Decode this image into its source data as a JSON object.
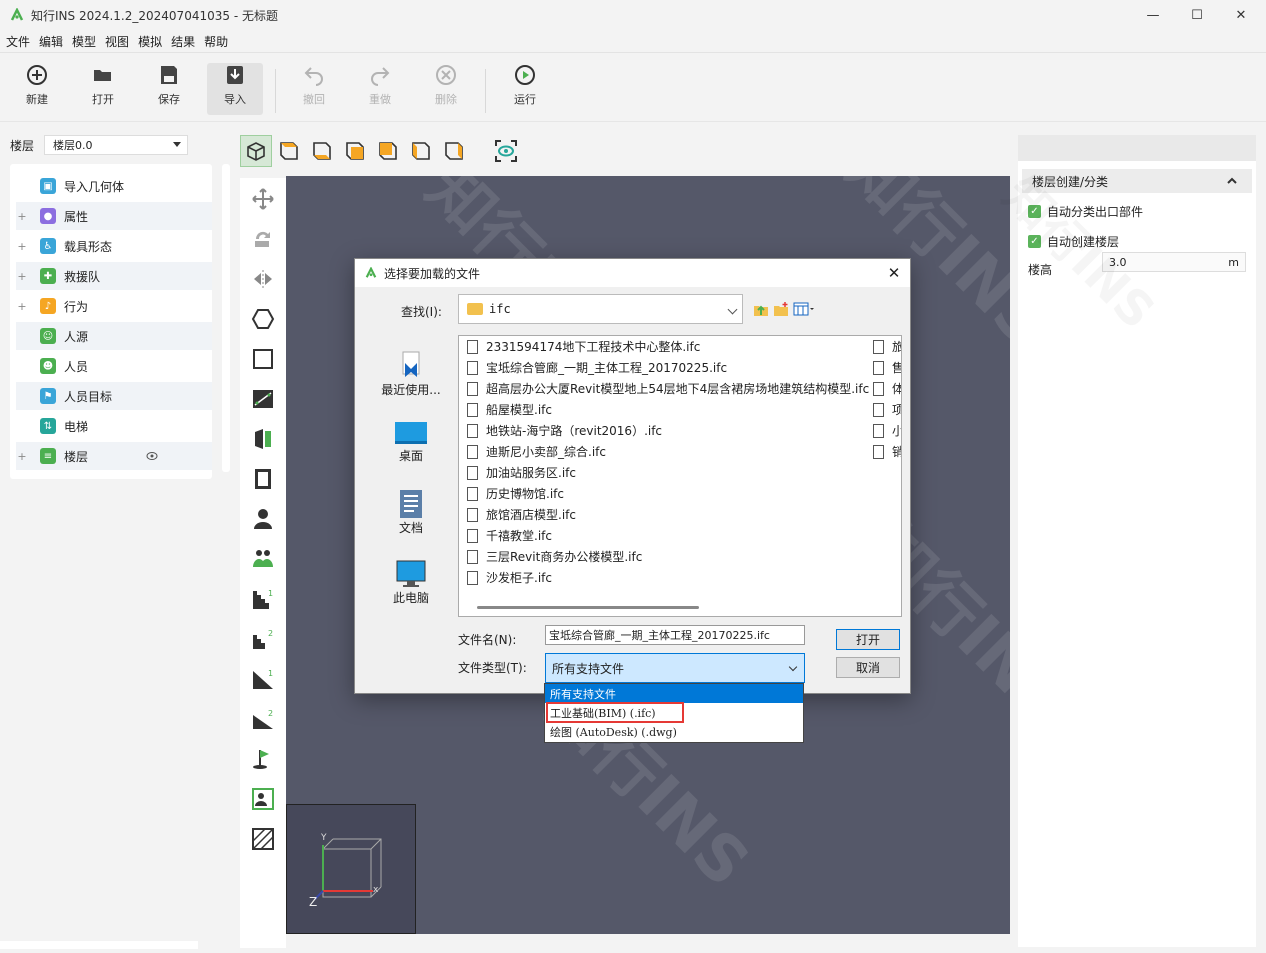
{
  "window": {
    "title": "知行INS 2024.1.2_202407041035 - 无标题",
    "controls": [
      "—",
      "☐",
      "✕"
    ]
  },
  "menu": [
    "文件",
    "编辑",
    "模型",
    "视图",
    "模拟",
    "结果",
    "帮助"
  ],
  "toolbar": {
    "new": "新建",
    "open": "打开",
    "save": "保存",
    "import": "导入",
    "undo": "撤回",
    "redo": "重做",
    "delete": "删除",
    "run": "运行"
  },
  "floor": {
    "label": "楼层",
    "value": "楼层0.0"
  },
  "tree": [
    {
      "label": "导入几何体",
      "expand": "",
      "color": "#3aa5d8"
    },
    {
      "label": "属性",
      "expand": "+",
      "color": "#8c6ee0"
    },
    {
      "label": "载具形态",
      "expand": "+",
      "color": "#3aa5d8"
    },
    {
      "label": "救援队",
      "expand": "+",
      "color": "#4caf50"
    },
    {
      "label": "行为",
      "expand": "+",
      "color": "#f5a623"
    },
    {
      "label": "人源",
      "expand": "",
      "color": "#4caf50"
    },
    {
      "label": "人员",
      "expand": "",
      "color": "#4caf50"
    },
    {
      "label": "人员目标",
      "expand": "",
      "color": "#3aa5d8"
    },
    {
      "label": "电梯",
      "expand": "",
      "color": "#26a69a"
    },
    {
      "label": "楼层",
      "expand": "+",
      "color": "#4caf50"
    }
  ],
  "right_panel": {
    "section": "楼层创建/分类",
    "check1": "自动分类出口部件",
    "check2": "自动创建楼层",
    "height_label": "楼高",
    "height_value": "3.0",
    "height_unit": "m"
  },
  "watermark": "知行INS",
  "axes": {
    "x": "x",
    "y": "Y",
    "z": "Z"
  },
  "dialog": {
    "title": "选择要加载的文件",
    "look_in_label": "查找(I):",
    "look_in_value": "ifc",
    "places": [
      "最近使用...",
      "桌面",
      "文档",
      "此电脑"
    ],
    "files": [
      "2331594174地下工程技术中心整体.ifc",
      "宝坻综合管廊_一期_主体工程_20170225.ifc",
      "超高层办公大厦Revit模型地上54层地下4层含裙房场地建筑结构模型.ifc",
      "船屋模型.ifc",
      "地铁站-海宁路（revit2016）.ifc",
      "迪斯尼小卖部_综合.ifc",
      "加油站服务区.ifc",
      "历史博物馆.ifc",
      "旅馆酒店模型.ifc",
      "千禧教堂.ifc",
      "三层Revit商务办公楼模型.ifc",
      "沙发柜子.ifc"
    ],
    "files_col2": [
      "旅",
      "售",
      "体",
      "项",
      "小",
      "销"
    ],
    "filename_label": "文件名(N):",
    "filename_value": "宝坻综合管廊_一期_主体工程_20170225.ifc",
    "filetype_label": "文件类型(T):",
    "filetype_value": "所有支持文件",
    "open": "打开",
    "cancel": "取消",
    "filetype_options": [
      "所有支持文件",
      "工业基础(BIM) (.ifc)",
      "绘图 (AutoDesk) (.dwg)"
    ]
  }
}
